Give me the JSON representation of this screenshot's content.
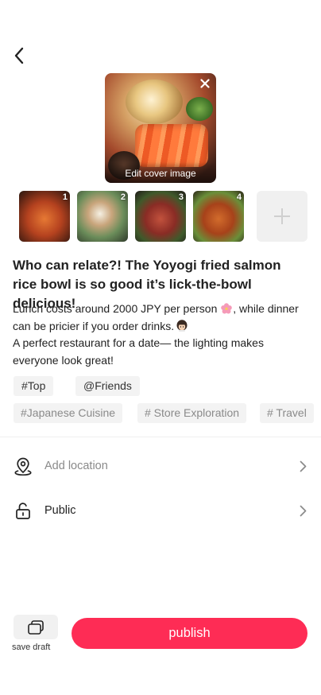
{
  "header": {
    "back_icon": "chevron-left-icon"
  },
  "cover": {
    "edit_label": "Edit cover image",
    "close_icon": "close-icon"
  },
  "thumbnails": [
    {
      "number": "1"
    },
    {
      "number": "2"
    },
    {
      "number": "3"
    },
    {
      "number": "4"
    }
  ],
  "add_image_icon": "plus-icon",
  "post": {
    "title": "Who can relate?! The Yoyogi fried salmon rice bowl is so good it’s lick-the-bowl delicious!",
    "body_line1_text": "Lunch costs around 2000 JPY per person",
    "body_line1_tail": ", while dinner",
    "body_line2": "can be pricier if you order drinks.",
    "body_line3": "A perfect restaurant for a date— the lighting makes",
    "body_line4": "everyone look great!"
  },
  "tags": {
    "top": "#Top",
    "friends": "@Friends",
    "japanese": "#Japanese Cuisine",
    "store": "# Store Exploration",
    "travel": "# Travel"
  },
  "options": {
    "location": {
      "label": "Add location",
      "icon": "location-pin-icon"
    },
    "visibility": {
      "label": "Public",
      "icon": "unlock-icon"
    }
  },
  "actions": {
    "draft_label": "save draft",
    "draft_icon": "drafts-icon",
    "publish_label": "publish"
  },
  "colors": {
    "accent": "#fe2c55",
    "tag_bg": "#f3f3f3",
    "muted_text": "#8a8a8a"
  }
}
